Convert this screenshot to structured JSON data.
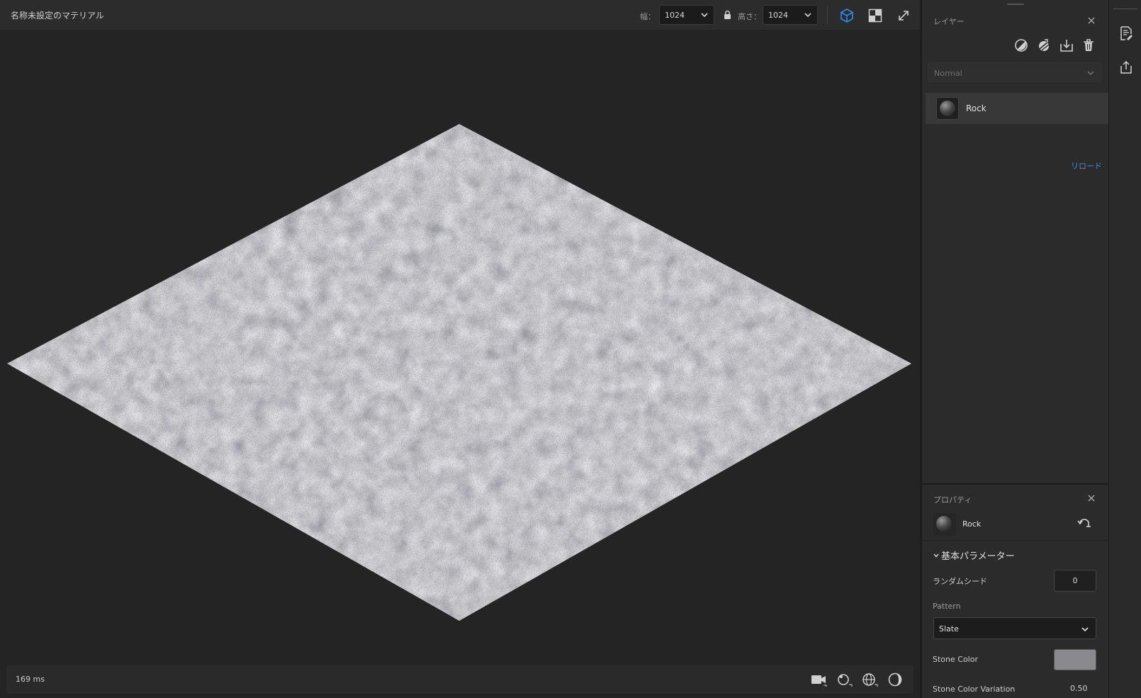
{
  "topbar": {
    "doc_title": "名称未設定のマテリアル",
    "width_label": "幅：",
    "width_value": "1024",
    "height_label": "高さ：",
    "height_value": "1024",
    "icons": [
      "3d-cube-icon",
      "2d-view-icon",
      "expand-icon"
    ],
    "active_color": "#2a8cf0"
  },
  "viewport": {
    "render_time": "169 ms",
    "icons": [
      "camera-icon",
      "light-rotate-icon",
      "environment-icon",
      "material-sphere-icon"
    ]
  },
  "layers": {
    "title": "レイヤー",
    "blend_mode": "Normal",
    "tools": [
      "mask-icon",
      "fill-icon",
      "import-icon",
      "trash-icon"
    ],
    "items": [
      {
        "name": "Rock"
      }
    ],
    "reload_label": "リロード"
  },
  "properties": {
    "title": "プロパティ",
    "layer_name": "Rock",
    "section": "基本パラメーター",
    "random_seed_label": "ランダムシード",
    "random_seed_value": "0",
    "pattern_label": "Pattern",
    "pattern_value": "Slate",
    "stone_color_label": "Stone Color",
    "stone_color": "#8a8a8e",
    "stone_color_variation_label": "Stone Color Variation",
    "stone_color_variation_value": "0.50"
  }
}
